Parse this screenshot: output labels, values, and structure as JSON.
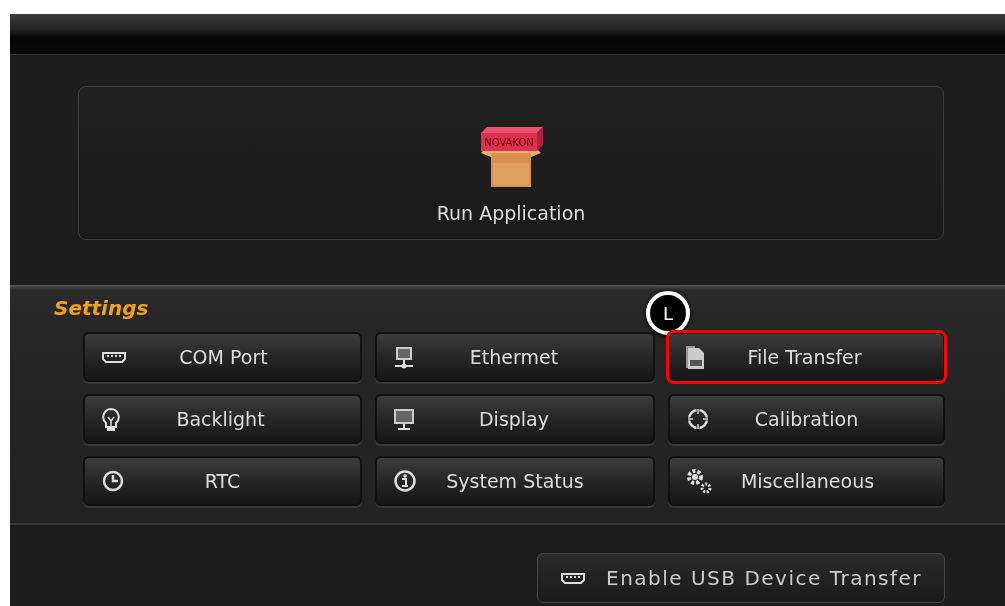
{
  "run_application": {
    "label": "Run Application",
    "box_text": "NOVAKON"
  },
  "settings": {
    "title": "Settings",
    "buttons": [
      {
        "label": "COM Port",
        "highlighted": false
      },
      {
        "label": "Ethermet",
        "highlighted": false
      },
      {
        "label": "File Transfer",
        "highlighted": true
      },
      {
        "label": "Backlight",
        "highlighted": false
      },
      {
        "label": "Display",
        "highlighted": false
      },
      {
        "label": "Calibration",
        "highlighted": false
      },
      {
        "label": "RTC",
        "highlighted": false
      },
      {
        "label": "System Status",
        "highlighted": false
      },
      {
        "label": "Miscellaneous",
        "highlighted": false
      }
    ]
  },
  "callout": "L",
  "usb_button": {
    "label": "Enable USB Device Transfer"
  }
}
